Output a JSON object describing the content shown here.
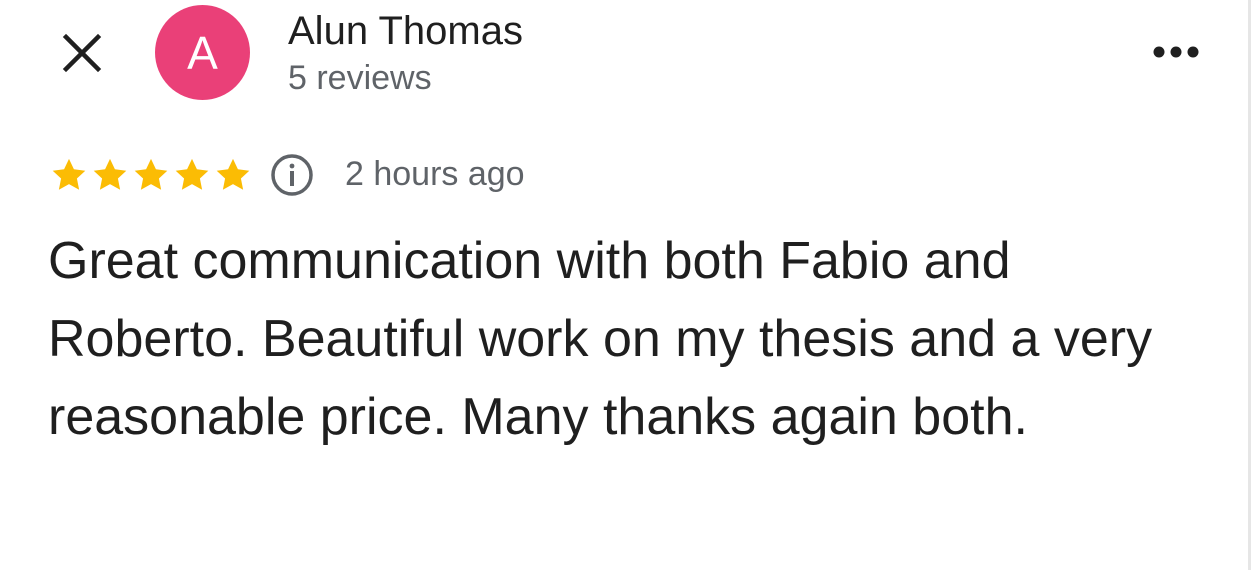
{
  "reviewer": {
    "avatar_letter": "A",
    "avatar_color": "#ea4078",
    "name": "Alun Thomas",
    "review_count": "5 reviews"
  },
  "review": {
    "rating": 5,
    "rating_max": 5,
    "star_color": "#fbbc04",
    "time_ago": "2 hours ago",
    "text": "Great communication with both Fabio and Roberto. Beautiful work on my thesis and a very reasonable price. Many thanks again both."
  },
  "icons": {
    "close": "close-icon",
    "more": "more-horizontal-icon",
    "info": "info-icon",
    "star": "star-icon"
  }
}
